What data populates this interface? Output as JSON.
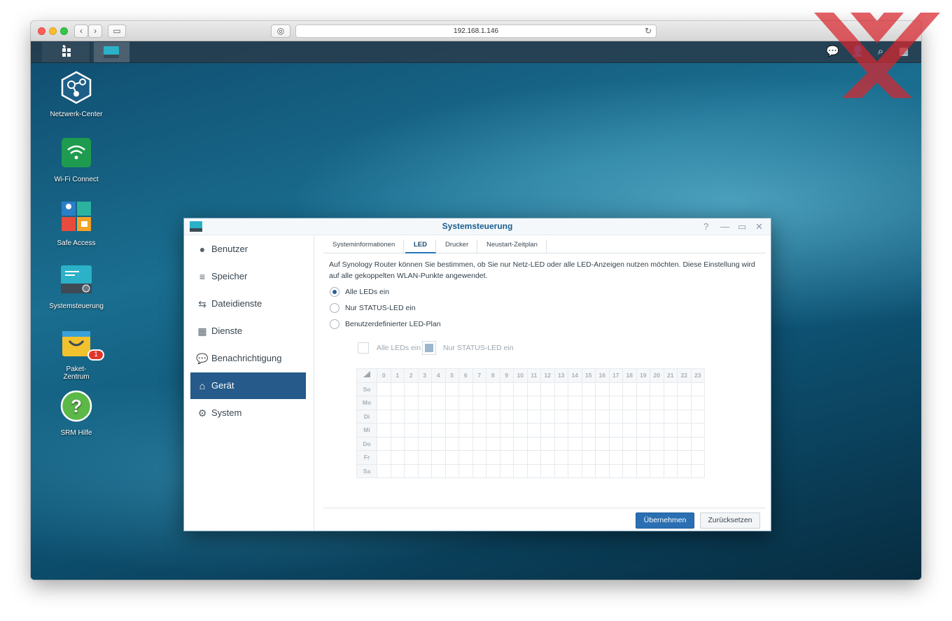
{
  "browser": {
    "url": "192.168.1.146"
  },
  "desktop_icons": [
    {
      "label": "Netzwerk-Center",
      "icon": "network-center-icon"
    },
    {
      "label": "Wi-Fi Connect",
      "icon": "wifi-icon"
    },
    {
      "label": "Safe Access",
      "icon": "safe-access-icon"
    },
    {
      "label": "Systemsteuerung",
      "icon": "control-panel-icon"
    },
    {
      "label": "Paket-\nZentrum",
      "icon": "package-center-icon",
      "badge": "1"
    },
    {
      "label": "SRM Hilfe",
      "icon": "help-icon"
    }
  ],
  "window": {
    "title": "Systemsteuerung",
    "controls": {
      "help": "?",
      "minimize": "—",
      "maximize": "▭",
      "close": "✕"
    }
  },
  "sidebar": {
    "items": [
      {
        "label": "Benutzer",
        "icon": "user-icon"
      },
      {
        "label": "Speicher",
        "icon": "storage-icon"
      },
      {
        "label": "Dateidienste",
        "icon": "file-services-icon"
      },
      {
        "label": "Dienste",
        "icon": "services-icon"
      },
      {
        "label": "Benachrichtigung",
        "icon": "notification-icon"
      },
      {
        "label": "Gerät",
        "icon": "router-icon",
        "active": true
      },
      {
        "label": "System",
        "icon": "gear-icon"
      }
    ]
  },
  "tabs": [
    {
      "label": "Systeminformationen"
    },
    {
      "label": "LED",
      "active": true
    },
    {
      "label": "Drucker"
    },
    {
      "label": "Neustart-Zeitplan"
    }
  ],
  "led": {
    "description": "Auf Synology Router können Sie bestimmen, ob Sie nur Netz-LED oder alle LED-Anzeigen nutzen möchten. Diese Einstellung wird auf alle gekoppelten WLAN-Punkte angewendet.",
    "options": [
      {
        "label": "Alle LEDs ein",
        "selected": true
      },
      {
        "label": "Nur STATUS-LED ein",
        "selected": false
      },
      {
        "label": "Benutzerdefinierter LED-Plan",
        "selected": false
      }
    ],
    "legend": {
      "all_on": "Alle LEDs ein",
      "status_only": "Nur STATUS-LED ein"
    },
    "schedule": {
      "hours": [
        "0",
        "1",
        "2",
        "3",
        "4",
        "5",
        "6",
        "7",
        "8",
        "9",
        "10",
        "11",
        "12",
        "13",
        "14",
        "15",
        "16",
        "17",
        "18",
        "19",
        "20",
        "21",
        "22",
        "23"
      ],
      "days": [
        "So",
        "Mo",
        "Di",
        "Mi",
        "Do",
        "Fr",
        "Sa"
      ]
    }
  },
  "buttons": {
    "apply": "Übernehmen",
    "reset": "Zurücksetzen"
  },
  "colors": {
    "accent": "#2a6fb2",
    "sidebar_active": "#255a8a",
    "title": "#1b5d8f"
  }
}
